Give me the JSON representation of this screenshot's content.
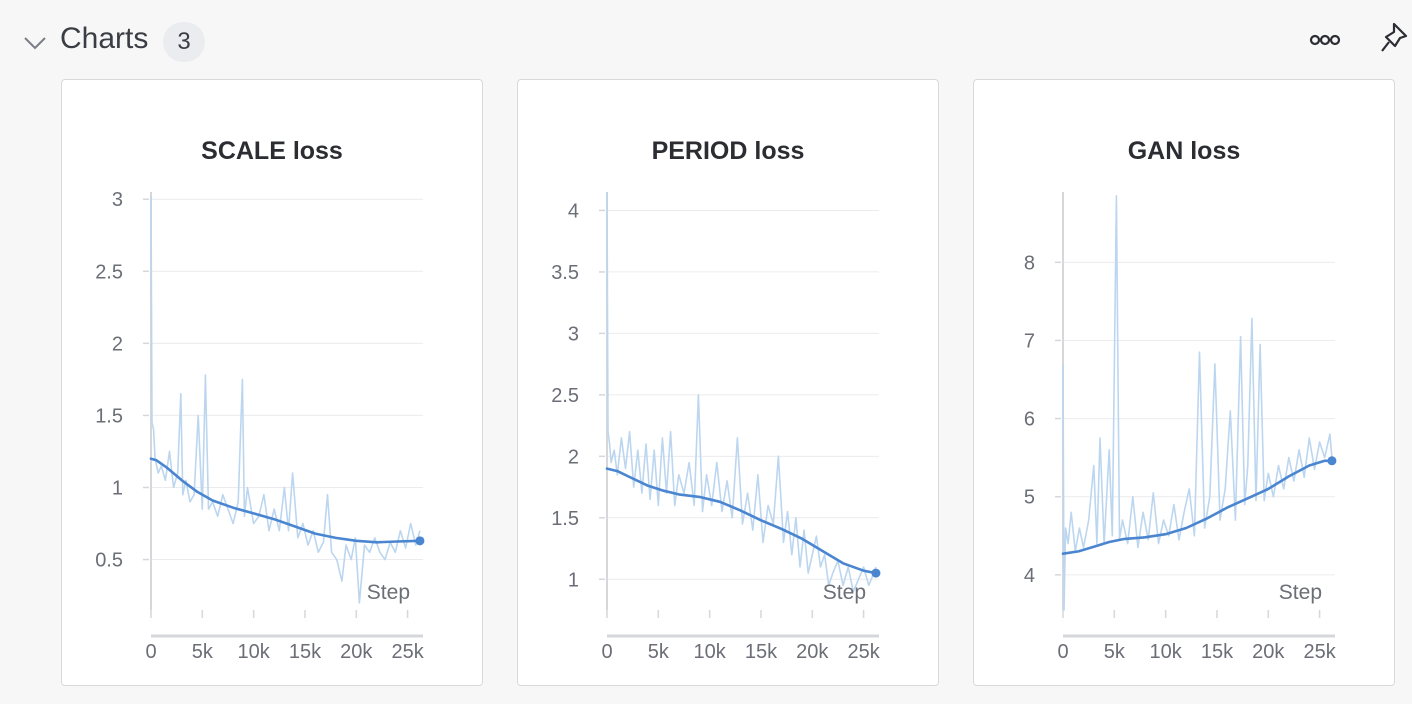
{
  "section": {
    "title": "Charts",
    "count": "3",
    "icons": {
      "collapse": "chevron-down-icon",
      "more": "more-options-icon",
      "pin": "pin-icon"
    }
  },
  "colors": {
    "line": "#4a85d0",
    "raw": "#bcd6f0",
    "grid": "#ececef",
    "axis": "#d6d7db",
    "text": "#6b6e76"
  },
  "chart_data": [
    {
      "type": "line",
      "title": "SCALE loss",
      "xlabel": "Step",
      "xlim": [
        0,
        26500
      ],
      "ylim": [
        0.15,
        3.05
      ],
      "xticks": [
        0,
        5000,
        10000,
        15000,
        20000,
        25000
      ],
      "xtick_labels": [
        "0",
        "5k",
        "10k",
        "15k",
        "20k",
        "25k"
      ],
      "yticks": [
        0.5,
        1,
        1.5,
        2,
        2.5,
        3
      ],
      "ytick_labels": [
        "0.5",
        "1",
        "1.5",
        "2",
        "2.5",
        "3"
      ],
      "series": [
        {
          "smoothed": true,
          "x": [
            0,
            500,
            1500,
            3000,
            4500,
            6000,
            8000,
            10000,
            12000,
            14000,
            16000,
            18000,
            20000,
            22000,
            24000,
            26200
          ],
          "y": [
            1.2,
            1.19,
            1.14,
            1.05,
            0.97,
            0.91,
            0.86,
            0.82,
            0.78,
            0.73,
            0.68,
            0.65,
            0.63,
            0.62,
            0.625,
            0.63
          ]
        },
        {
          "raw": true,
          "x": [
            0,
            100,
            250,
            400,
            700,
            1000,
            1400,
            1800,
            2200,
            2600,
            2900,
            3100,
            3400,
            3800,
            4200,
            4600,
            5000,
            5300,
            5600,
            6000,
            6500,
            7000,
            7500,
            8000,
            8500,
            8900,
            9100,
            9400,
            10000,
            10500,
            11000,
            11500,
            12000,
            12500,
            13000,
            13400,
            13800,
            14300,
            14800,
            15300,
            15800,
            16300,
            16800,
            17200,
            17600,
            18100,
            18600,
            19000,
            19500,
            19900,
            20300,
            20800,
            21300,
            21800,
            22300,
            22800,
            23300,
            23800,
            24300,
            24800,
            25300,
            25800,
            26200
          ],
          "y": [
            3.02,
            1.45,
            1.4,
            1.2,
            1.1,
            1.15,
            1.05,
            1.25,
            1.0,
            1.1,
            1.65,
            0.95,
            1.05,
            0.9,
            0.95,
            1.5,
            0.85,
            1.78,
            0.85,
            0.9,
            0.8,
            0.95,
            0.85,
            0.75,
            0.9,
            1.75,
            0.8,
            1.0,
            0.75,
            0.8,
            0.95,
            0.7,
            0.85,
            0.7,
            1.0,
            0.7,
            1.1,
            0.65,
            0.75,
            0.6,
            0.7,
            0.55,
            0.62,
            0.95,
            0.55,
            0.5,
            0.35,
            0.6,
            0.5,
            0.65,
            0.2,
            0.6,
            0.55,
            0.65,
            0.55,
            0.5,
            0.62,
            0.55,
            0.7,
            0.58,
            0.75,
            0.6,
            0.7
          ]
        }
      ]
    },
    {
      "type": "line",
      "title": "PERIOD loss",
      "xlabel": "Step",
      "xlim": [
        0,
        26500
      ],
      "ylim": [
        0.75,
        4.15
      ],
      "xticks": [
        0,
        5000,
        10000,
        15000,
        20000,
        25000
      ],
      "xtick_labels": [
        "0",
        "5k",
        "10k",
        "15k",
        "20k",
        "25k"
      ],
      "yticks": [
        1,
        1.5,
        2,
        2.5,
        3,
        3.5,
        4
      ],
      "ytick_labels": [
        "1",
        "1.5",
        "2",
        "2.5",
        "3",
        "3.5",
        "4"
      ],
      "series": [
        {
          "smoothed": true,
          "x": [
            0,
            1000,
            2500,
            4000,
            5500,
            7000,
            9000,
            11000,
            13000,
            15000,
            17000,
            19000,
            21000,
            23000,
            25000,
            26200
          ],
          "y": [
            1.9,
            1.88,
            1.82,
            1.76,
            1.72,
            1.69,
            1.67,
            1.63,
            1.56,
            1.48,
            1.41,
            1.33,
            1.23,
            1.13,
            1.07,
            1.05
          ]
        },
        {
          "raw": true,
          "x": [
            0,
            100,
            250,
            400,
            700,
            1000,
            1400,
            1800,
            2200,
            2600,
            3000,
            3400,
            3800,
            4200,
            4600,
            5000,
            5400,
            5800,
            6200,
            6600,
            7000,
            7500,
            8000,
            8500,
            8900,
            9300,
            9700,
            10200,
            10700,
            11200,
            11700,
            12200,
            12700,
            13200,
            13700,
            14200,
            14700,
            15200,
            15700,
            16200,
            16700,
            17200,
            17600,
            18000,
            18400,
            18800,
            19200,
            19600,
            20000,
            20400,
            20800,
            21200,
            21600,
            22000,
            22500,
            23000,
            23500,
            24000,
            24500,
            25000,
            25500,
            26000,
            26200
          ],
          "y": [
            4.15,
            2.2,
            2.1,
            1.95,
            2.05,
            1.85,
            2.15,
            1.9,
            2.2,
            1.75,
            2.05,
            1.7,
            2.1,
            1.65,
            2.05,
            1.6,
            2.15,
            1.7,
            2.2,
            1.6,
            1.85,
            1.7,
            1.95,
            1.6,
            2.5,
            1.55,
            1.85,
            1.6,
            1.95,
            1.55,
            1.8,
            1.5,
            2.15,
            1.45,
            1.7,
            1.4,
            1.85,
            1.3,
            1.6,
            1.45,
            2.0,
            1.3,
            1.55,
            1.2,
            1.5,
            1.1,
            1.4,
            1.05,
            1.2,
            1.35,
            1.1,
            1.2,
            0.95,
            1.05,
            1.15,
            0.95,
            1.1,
            0.9,
            1.0,
            1.1,
            0.95,
            1.05,
            1.1
          ]
        }
      ]
    },
    {
      "type": "line",
      "title": "GAN loss",
      "xlabel": "Step",
      "xlim": [
        0,
        26500
      ],
      "ylim": [
        3.55,
        8.9
      ],
      "xticks": [
        0,
        5000,
        10000,
        15000,
        20000,
        25000
      ],
      "xtick_labels": [
        "0",
        "5k",
        "10k",
        "15k",
        "20k",
        "25k"
      ],
      "yticks": [
        4,
        5,
        6,
        7,
        8
      ],
      "ytick_labels": [
        "4",
        "5",
        "6",
        "7",
        "8"
      ],
      "series": [
        {
          "smoothed": true,
          "x": [
            0,
            1500,
            3000,
            4500,
            6000,
            8000,
            10000,
            12000,
            14000,
            16000,
            18000,
            20000,
            22000,
            24000,
            25500,
            26200
          ],
          "y": [
            4.27,
            4.3,
            4.36,
            4.42,
            4.46,
            4.48,
            4.52,
            4.6,
            4.72,
            4.86,
            4.98,
            5.1,
            5.26,
            5.4,
            5.46,
            5.46
          ]
        },
        {
          "raw": true,
          "x": [
            0,
            100,
            250,
            500,
            800,
            1200,
            1600,
            2000,
            2500,
            3000,
            3300,
            3600,
            4000,
            4500,
            4800,
            5200,
            5500,
            5800,
            6300,
            6800,
            7300,
            7800,
            8300,
            8800,
            9300,
            9800,
            10300,
            10800,
            11300,
            11800,
            12300,
            12800,
            13300,
            13800,
            14300,
            14800,
            15300,
            15800,
            16300,
            16800,
            17300,
            17700,
            18000,
            18400,
            18800,
            19200,
            19600,
            20000,
            20500,
            21000,
            21500,
            22000,
            22500,
            23000,
            23500,
            24000,
            24500,
            25000,
            25500,
            26000,
            26200
          ],
          "y": [
            6.7,
            3.55,
            4.6,
            4.4,
            4.8,
            4.3,
            4.6,
            4.35,
            4.7,
            5.4,
            4.4,
            5.75,
            4.4,
            5.6,
            4.5,
            8.85,
            4.45,
            4.7,
            4.4,
            5.0,
            4.35,
            4.8,
            4.45,
            5.05,
            4.4,
            4.7,
            4.5,
            4.9,
            4.45,
            4.8,
            5.1,
            4.5,
            6.85,
            4.6,
            5.0,
            6.7,
            4.7,
            5.1,
            6.1,
            4.7,
            7.05,
            4.9,
            5.4,
            7.28,
            4.95,
            6.95,
            4.95,
            5.3,
            5.0,
            5.4,
            5.1,
            5.5,
            5.2,
            5.6,
            5.25,
            5.75,
            5.35,
            5.7,
            5.5,
            5.8,
            5.5
          ]
        }
      ]
    }
  ]
}
